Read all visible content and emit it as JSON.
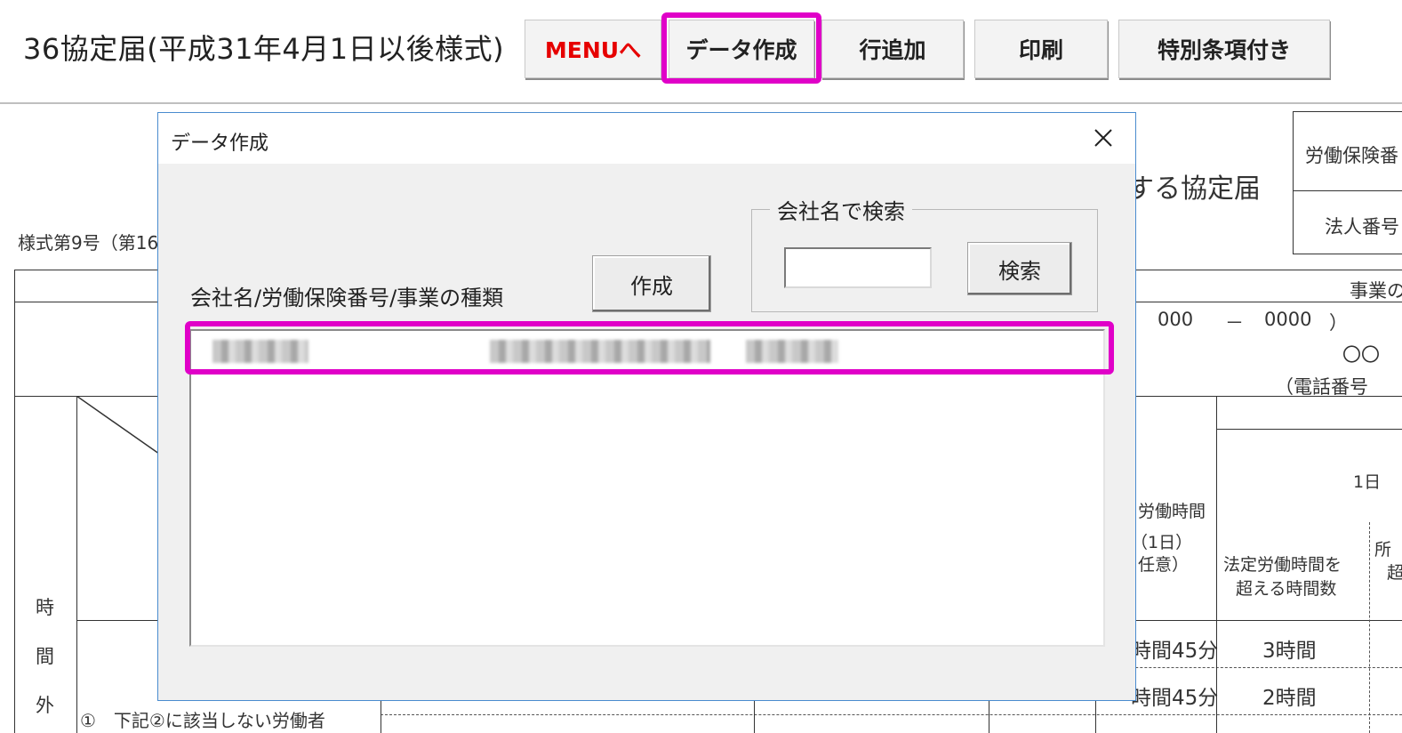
{
  "app": {
    "title": "36協定届(平成31年4月1日以後様式)"
  },
  "toolbar": {
    "menu_label": "MENUへ",
    "data_create_label": "データ作成",
    "add_row_label": "行追加",
    "print_label": "印刷",
    "special_clause_label": "特別条項付き"
  },
  "sheet": {
    "title_fragment": "する協定届",
    "form_number": "様式第9号（第16",
    "labor_insurance": "労働保険番",
    "corporate_number": "法人番号",
    "business_label": "事業の",
    "postal_a": "000",
    "postal_dash": "－",
    "postal_b": "0000",
    "postal_close": "）",
    "circles": "〇〇",
    "phone": "（電話番号",
    "day_label": "1日",
    "working_hours": "労働時間",
    "one_day": "（1日）",
    "optional": "任意）",
    "legal_hours_line1": "法定労働時間を",
    "legal_hours_line2": "超える時間数",
    "time_45_a": "時間45分",
    "time_45_b": "時間45分",
    "hours_3": "3時間",
    "hours_2": "2時間",
    "side_ji": "時",
    "side_kan": "間",
    "side_gai": "外",
    "worker_note": "①　下記②に該当しない労働者",
    "partial_sho": "所",
    "partial_cho": "超"
  },
  "dialog": {
    "title": "データ作成",
    "list_label": "会社名/労働保険番号/事業の種類",
    "create_button": "作成",
    "search_group_label": "会社名で検索",
    "search_input_value": "",
    "search_button": "検索"
  },
  "colors": {
    "highlight": "#e000c8",
    "menu_text": "#e60000",
    "dialog_border": "#4a8ccf",
    "dialog_bg": "#f0f0f0"
  }
}
